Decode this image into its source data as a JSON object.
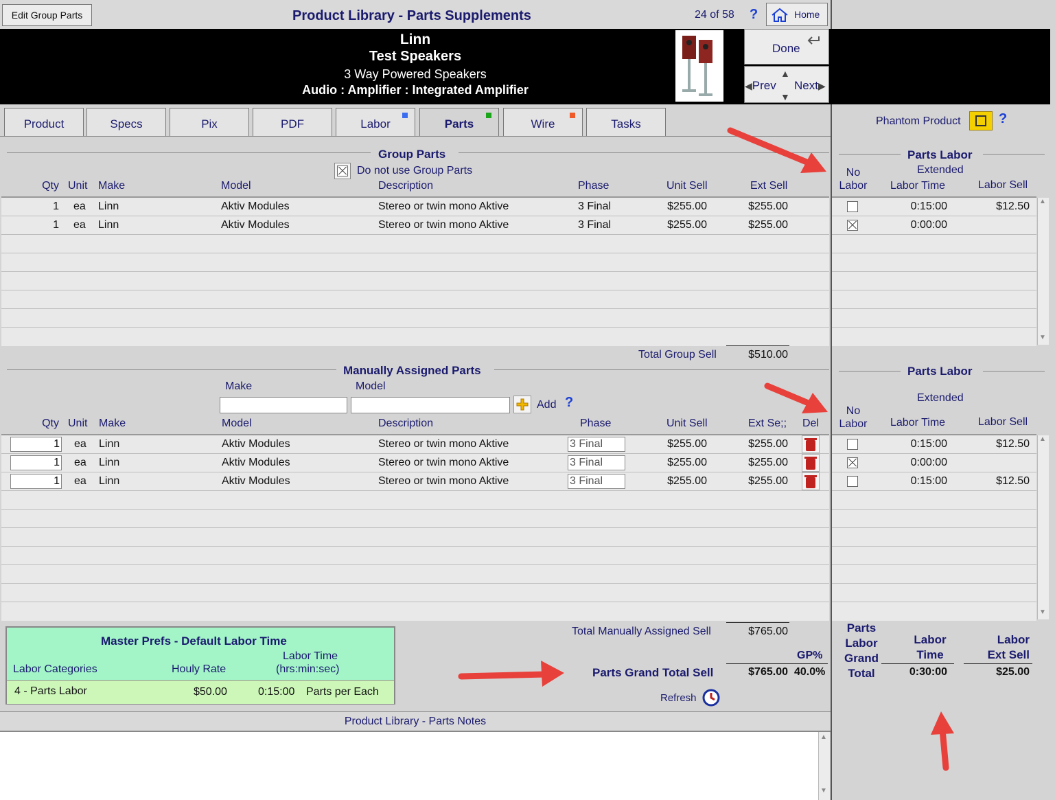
{
  "topbar": {
    "edit_button": "Edit Group Parts",
    "title": "Product Library - Parts Supplements",
    "record_count": "24 of 58",
    "help": "?",
    "home": "Home"
  },
  "header": {
    "make": "Linn",
    "name": "Test Speakers",
    "description": "3 Way Powered Speakers",
    "category": "Audio : Amplifier : Integrated Amplifier",
    "done": "Done",
    "prev": "Prev",
    "next": "Next"
  },
  "tabs": [
    {
      "label": "Product"
    },
    {
      "label": "Specs"
    },
    {
      "label": "Pix"
    },
    {
      "label": "PDF"
    },
    {
      "label": "Labor",
      "marker": "#3b6df0"
    },
    {
      "label": "Parts",
      "marker": "#1aa51a"
    },
    {
      "label": "Wire",
      "marker": "#f05a28"
    },
    {
      "label": "Tasks"
    }
  ],
  "phantom": {
    "label": "Phantom Product",
    "help": "?"
  },
  "group_parts": {
    "title": "Group Parts",
    "checkbox_label": "Do not use Group Parts",
    "columns": {
      "qty": "Qty",
      "unit": "Unit",
      "make": "Make",
      "model": "Model",
      "description": "Description",
      "phase": "Phase",
      "unit_sell": "Unit Sell",
      "ext_sell": "Ext Sell"
    },
    "rows": [
      {
        "qty": "1",
        "unit": "ea",
        "make": "Linn",
        "model": "Aktiv Modules",
        "description": "Stereo or twin mono Aktive",
        "phase": "3 Final",
        "unit_sell": "$255.00",
        "ext_sell": "$255.00"
      },
      {
        "qty": "1",
        "unit": "ea",
        "make": "Linn",
        "model": "Aktiv Modules",
        "description": "Stereo or twin mono Aktive",
        "phase": "3 Final",
        "unit_sell": "$255.00",
        "ext_sell": "$255.00"
      }
    ],
    "total_label": "Total Group Sell",
    "total_value": "$510.00"
  },
  "group_labor": {
    "title": "Parts Labor",
    "extended": "Extended",
    "no_labor_1": "No",
    "no_labor_2": "Labor",
    "labor_time": "Labor Time",
    "labor_sell": "Labor Sell",
    "rows": [
      {
        "no_labor": false,
        "time": "0:15:00",
        "sell": "$12.50"
      },
      {
        "no_labor": true,
        "time": "0:00:00",
        "sell": ""
      }
    ]
  },
  "manual_parts": {
    "title": "Manually Assigned Parts",
    "make_label": "Make",
    "model_label": "Model",
    "add_label": "Add",
    "help": "?",
    "columns": {
      "qty": "Qty",
      "unit": "Unit",
      "make": "Make",
      "model": "Model",
      "description": "Description",
      "phase": "Phase",
      "unit_sell": "Unit Sell",
      "ext_sell": "Ext Se;;",
      "del": "Del"
    },
    "rows": [
      {
        "qty": "1",
        "unit": "ea",
        "make": "Linn",
        "model": "Aktiv Modules",
        "description": "Stereo or twin mono Aktive",
        "phase": "3 Final",
        "unit_sell": "$255.00",
        "ext_sell": "$255.00"
      },
      {
        "qty": "1",
        "unit": "ea",
        "make": "Linn",
        "model": "Aktiv Modules",
        "description": "Stereo or twin mono Aktive",
        "phase": "3 Final",
        "unit_sell": "$255.00",
        "ext_sell": "$255.00"
      },
      {
        "qty": "1",
        "unit": "ea",
        "make": "Linn",
        "model": "Aktiv Modules",
        "description": "Stereo or twin mono Aktive",
        "phase": "3 Final",
        "unit_sell": "$255.00",
        "ext_sell": "$255.00"
      }
    ],
    "total_label": "Total Manually Assigned Sell",
    "total_value": "$765.00"
  },
  "manual_labor": {
    "title": "Parts Labor",
    "extended": "Extended",
    "no_labor_1": "No",
    "no_labor_2": "Labor",
    "labor_time": "Labor Time",
    "labor_sell": "Labor Sell",
    "rows": [
      {
        "no_labor": false,
        "time": "0:15:00",
        "sell": "$12.50"
      },
      {
        "no_labor": true,
        "time": "0:00:00",
        "sell": ""
      },
      {
        "no_labor": false,
        "time": "0:15:00",
        "sell": "$12.50"
      }
    ]
  },
  "master_prefs": {
    "title": "Master Prefs - Default Labor Time",
    "col_category": "Labor Categories",
    "col_rate": "Houly Rate",
    "col_time_1": "Labor Time",
    "col_time_2": "(hrs:min:sec)",
    "row": {
      "category": "4 - Parts Labor",
      "rate": "$50.00",
      "time": "0:15:00",
      "basis": "Parts per Each"
    }
  },
  "grand": {
    "gp_label": "GP%",
    "label": "Parts Grand Total Sell",
    "value": "$765.00",
    "gp": "40.0%",
    "refresh": "Refresh"
  },
  "labor_grand": {
    "title_1": "Parts",
    "title_2": "Labor",
    "title_3": "Grand",
    "title_4": "Total",
    "time_1": "Labor",
    "time_2": "Time",
    "time_value": "0:30:00",
    "sell_1": "Labor",
    "sell_2": "Ext Sell",
    "sell_value": "$25.00"
  },
  "notes": {
    "title": "Product Library - Parts Notes"
  },
  "colors": {
    "header_bg": "#000000",
    "prefs_bg": "#a3f5c8",
    "arrow": "#e8403a",
    "title_navy": "#1a1a6e"
  }
}
